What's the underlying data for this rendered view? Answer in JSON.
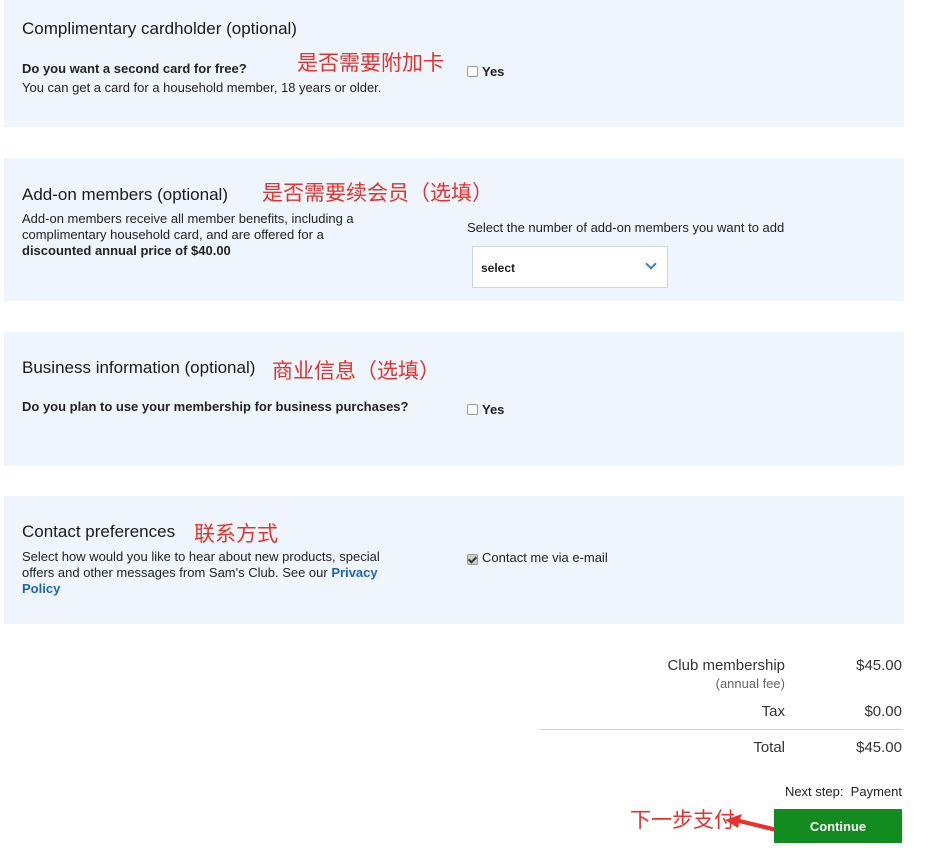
{
  "cardholder": {
    "title": "Complimentary cardholder (optional)",
    "question": "Do you want a second card for free?",
    "description": "You can get a card for a household member, 18 years or older.",
    "checkbox_label": "Yes",
    "checked": false,
    "annotation": "是否需要附加卡"
  },
  "addon": {
    "title": "Add-on members (optional)",
    "desc_line1": "Add-on members receive all member benefits, including a",
    "desc_line2": "complimentary household card, and are offered for a",
    "desc_bold": "discounted annual price of $40.00",
    "select_prompt": "Select the number of add-on members you want to add",
    "select_value": "select",
    "annotation": "是否需要续会员（选填）"
  },
  "business": {
    "title": "Business information (optional)",
    "question": "Do you plan to use your membership for business purchases?",
    "checkbox_label": "Yes",
    "checked": false,
    "annotation": "商业信息（选填）"
  },
  "contact": {
    "title": "Contact preferences",
    "desc_line1": "Select how would you like to hear about new products, special",
    "desc_line2": "offers and other messages from Sam's Club. See our",
    "link_part1": "Privacy",
    "link_part2": "Policy",
    "checkbox_label": "Contact me via e-mail",
    "checked": true,
    "annotation": "联系方式"
  },
  "summary": {
    "membership_label": "Club membership",
    "membership_sub": "(annual fee)",
    "membership_amount": "$45.00",
    "tax_label": "Tax",
    "tax_amount": "$0.00",
    "total_label": "Total",
    "total_amount": "$45.00",
    "next_step": "Next step:  Payment",
    "continue_label": "Continue",
    "annotation": "下一步支付"
  },
  "colors": {
    "panel_bg": "#eef5fc",
    "annotation": "#e8312d",
    "button": "#118a1e",
    "link": "#1f64b2"
  }
}
